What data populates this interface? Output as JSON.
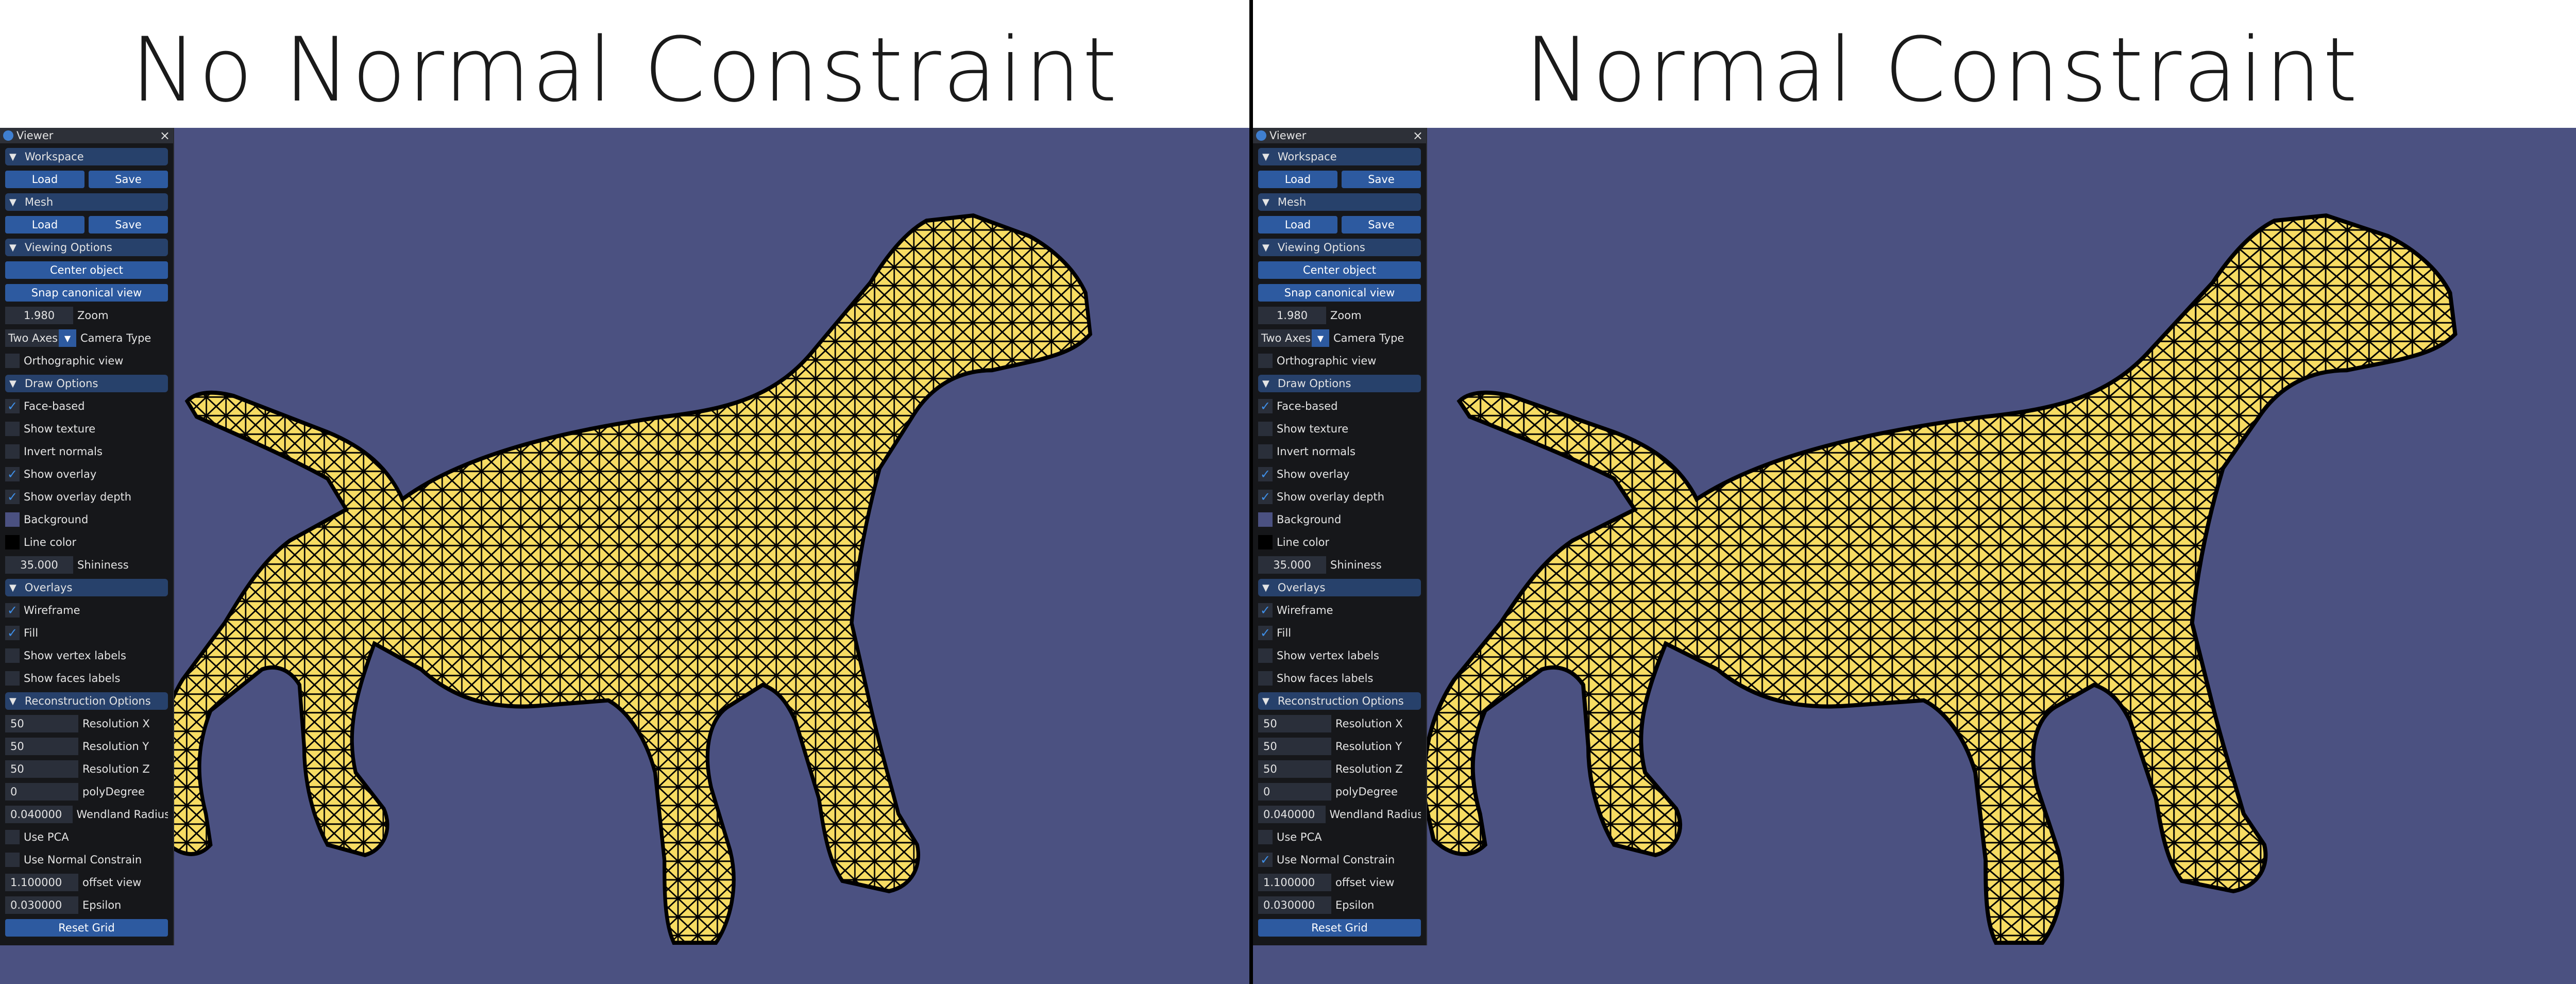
{
  "left": {
    "title": "No Normal Constraint",
    "use_normal_constraint": false
  },
  "right": {
    "title": "Normal Constraint",
    "use_normal_constraint": true
  },
  "panel": {
    "window_title": "Viewer",
    "close_symbol": "×",
    "workspace": {
      "header": "Workspace",
      "load": "Load",
      "save": "Save"
    },
    "mesh": {
      "header": "Mesh",
      "load": "Load",
      "save": "Save"
    },
    "viewing": {
      "header": "Viewing Options",
      "center": "Center object",
      "snap": "Snap canonical view",
      "zoom_value": "1.980",
      "zoom_label": "Zoom",
      "camera_value": "Two Axes",
      "camera_label": "Camera Type",
      "ortho_label": "Orthographic view"
    },
    "draw": {
      "header": "Draw Options",
      "face_based": "Face-based",
      "show_texture": "Show texture",
      "invert_normals": "Invert normals",
      "show_overlay": "Show overlay",
      "show_overlay_depth": "Show overlay depth",
      "background": "Background",
      "line_color": "Line color",
      "shininess_value": "35.000",
      "shininess_label": "Shininess"
    },
    "overlays": {
      "header": "Overlays",
      "wireframe": "Wireframe",
      "fill": "Fill",
      "vertex_labels": "Show vertex labels",
      "faces_labels": "Show faces labels"
    },
    "recon": {
      "header": "Reconstruction Options",
      "res_x_value": "50",
      "res_x_label": "Resolution X",
      "res_y_value": "50",
      "res_y_label": "Resolution Y",
      "res_z_value": "50",
      "res_z_label": "Resolution Z",
      "poly_value": "0",
      "poly_label": "polyDegree",
      "wend_value": "0.040000",
      "wend_label": "Wendland Radius I",
      "use_pca": "Use PCA",
      "use_normal": "Use Normal Constrain",
      "offset_value": "1.100000",
      "offset_label": "offset view",
      "eps_value": "0.030000",
      "eps_label": "Epsilon",
      "reset": "Reset Grid"
    }
  },
  "colors": {
    "viewport": "#4b5181",
    "mesh_fill": "#f7dc63",
    "mesh_line": "#000000",
    "background_swatch": "#4b5181",
    "line_swatch": "#000000"
  }
}
